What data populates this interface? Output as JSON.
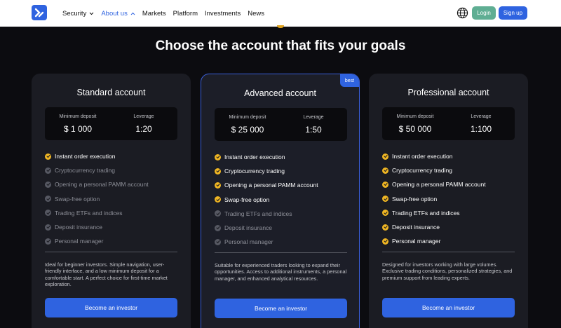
{
  "header": {
    "nav": [
      "Security",
      "About us",
      "Markets",
      "Platform",
      "Investments",
      "News"
    ],
    "login": "Login",
    "signup": "Sign up"
  },
  "main": {
    "title": "Choose the account that fits your goals"
  },
  "accounts": [
    {
      "name": "Standard account",
      "min_deposit_label": "Minimum deposit",
      "min_deposit": "$ 1 000",
      "leverage_label": "Leverage",
      "leverage": "1:20",
      "features": [
        {
          "text": "Instant order execution",
          "included": true
        },
        {
          "text": "Cryptocurrency trading",
          "included": false
        },
        {
          "text": "Opening a personal PAMM account",
          "included": false
        },
        {
          "text": "Swap-free option",
          "included": false
        },
        {
          "text": "Trading ETFs and indices",
          "included": false
        },
        {
          "text": "Deposit insurance",
          "included": false
        },
        {
          "text": "Personal manager",
          "included": false
        }
      ],
      "description": "Ideal for beginner investors. Simple navigation, user-friendly interface, and a low minimum deposit for a comfortable start. A perfect choice for first-time market exploration.",
      "cta": "Become an investor"
    },
    {
      "name": "Advanced account",
      "badge": "best",
      "min_deposit_label": "Minimum deposit",
      "min_deposit": "$ 25 000",
      "leverage_label": "Leverage",
      "leverage": "1:50",
      "features": [
        {
          "text": "Instant order execution",
          "included": true
        },
        {
          "text": "Cryptocurrency trading",
          "included": true
        },
        {
          "text": "Opening a personal PAMM account",
          "included": true
        },
        {
          "text": "Swap-free option",
          "included": true
        },
        {
          "text": "Trading ETFs and indices",
          "included": false
        },
        {
          "text": "Deposit insurance",
          "included": false
        },
        {
          "text": "Personal manager",
          "included": false
        }
      ],
      "description": "Suitable for experienced traders looking to expand their opportunities. Access to additional instruments, a personal manager, and enhanced analytical resources.",
      "cta": "Become an investor"
    },
    {
      "name": "Professional account",
      "min_deposit_label": "Minimum deposit",
      "min_deposit": "$ 50 000",
      "leverage_label": "Leverage",
      "leverage": "1:100",
      "features": [
        {
          "text": "Instant order execution",
          "included": true
        },
        {
          "text": "Cryptocurrency trading",
          "included": true
        },
        {
          "text": "Opening a personal PAMM account",
          "included": true
        },
        {
          "text": "Swap-free option",
          "included": true
        },
        {
          "text": "Trading ETFs and indices",
          "included": true
        },
        {
          "text": "Deposit insurance",
          "included": true
        },
        {
          "text": "Personal manager",
          "included": true
        }
      ],
      "description": "Designed for investors working with large volumes. Exclusive trading conditions, personalized strategies, and premium support from leading experts.",
      "cta": "Become an investor"
    }
  ],
  "colors": {
    "accent": "#2f63e0",
    "login": "#5fae93",
    "check": "#f0b623",
    "background": "#0c0c10",
    "card": "#1b1c23"
  },
  "icons": {
    "logo": "brand-logo-icon",
    "globe": "globe-icon",
    "chevron": "chevron-up-icon",
    "check": "check-circle-icon"
  }
}
